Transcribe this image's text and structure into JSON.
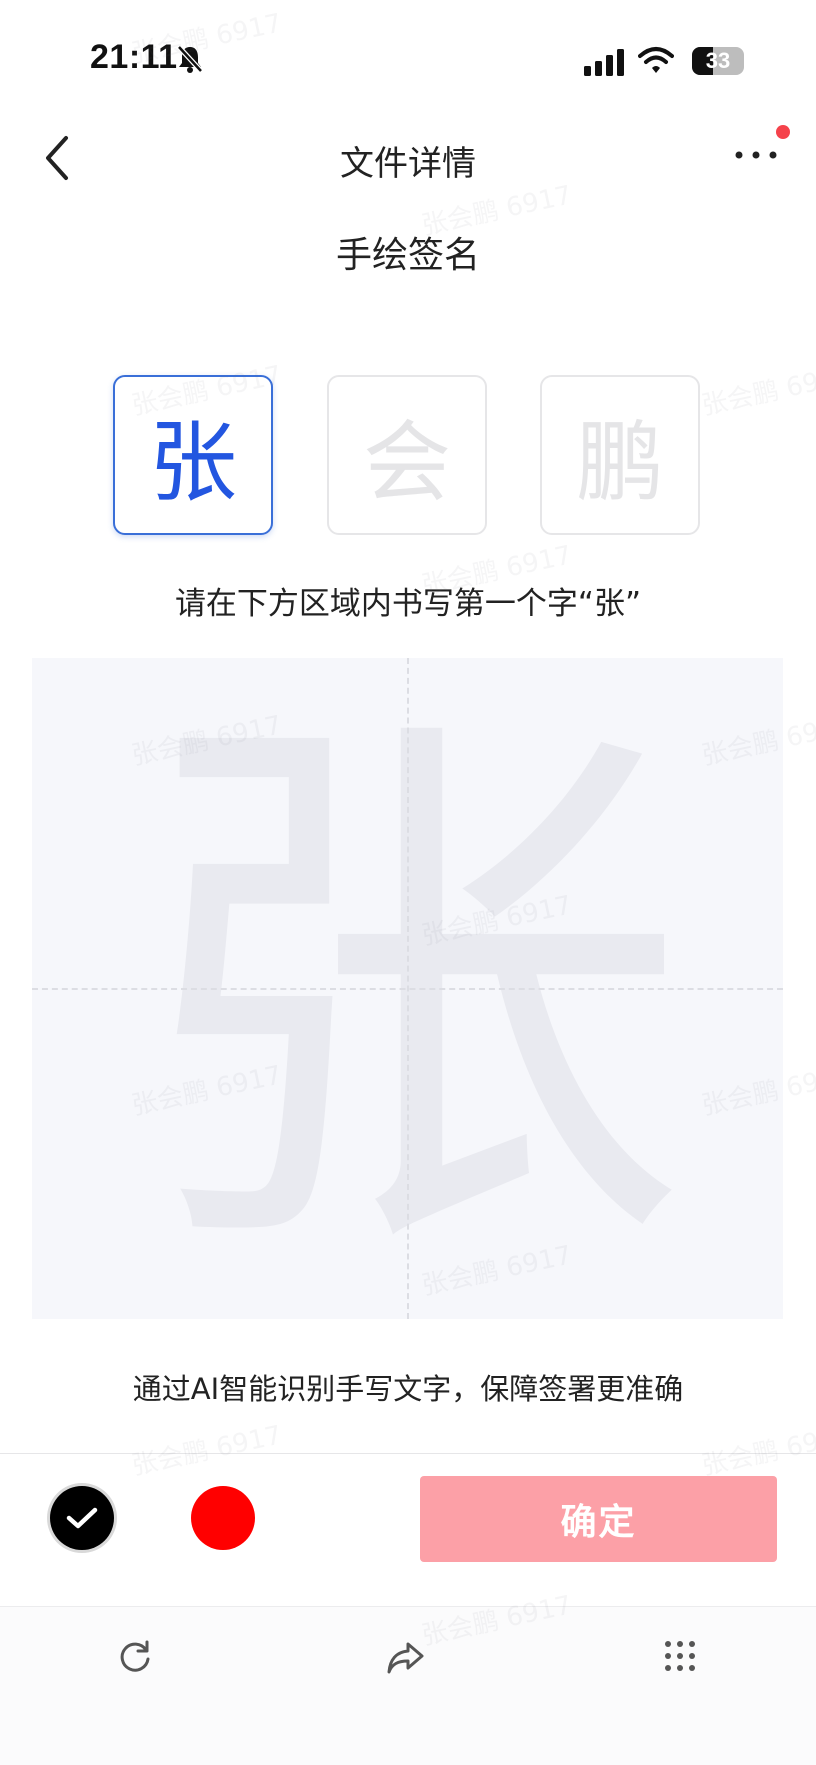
{
  "status_bar": {
    "time": "21:11",
    "battery": "33"
  },
  "nav": {
    "title": "文件详情"
  },
  "signature": {
    "title": "手绘签名",
    "characters": [
      {
        "char": "张",
        "active": true
      },
      {
        "char": "会",
        "active": false
      },
      {
        "char": "鹏",
        "active": false
      }
    ],
    "instruction": "请在下方区域内书写第一个字“张”",
    "guide_char": "张",
    "hint": "通过AI智能识别手写文字，保障签署更准确"
  },
  "pen_colors": [
    {
      "name": "black",
      "hex": "#000000",
      "selected": true
    },
    {
      "name": "red",
      "hex": "#ff0000",
      "selected": false
    }
  ],
  "actions": {
    "confirm_label": "确定"
  },
  "watermark": "张会鹏 6917",
  "colors": {
    "accent": "#2356e0",
    "confirm_bg": "#fca0a7",
    "notify": "#f5424b"
  },
  "toolbar": {
    "icons": [
      "refresh-icon",
      "share-icon",
      "grid-dots-icon"
    ]
  }
}
